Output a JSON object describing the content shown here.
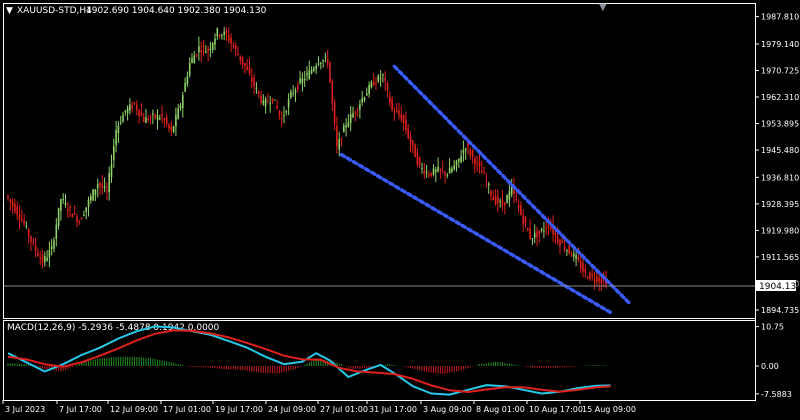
{
  "header": {
    "symbol": "XAUUSD-STD,H4",
    "ohlc": "1902.690 1904.640 1902.380 1904.130"
  },
  "indicator": {
    "label": "MACD(12,26,9) -5.2936 -5.4878 0.1942 0.0000"
  },
  "colors": {
    "background": "#000000",
    "grid_line": "#ffffff",
    "bull_candle": "#8fd36a",
    "bear_candle": "#e0201b",
    "channel": "#3a5bff",
    "macd_main": "#27c9e8",
    "macd_signal": "#e0201b",
    "hist_pos": "#1e8f1e",
    "hist_neg": "#c01a1a",
    "price_tag_bg": "#ffffff",
    "price_tag_text": "#000000",
    "text": "#ffffff"
  },
  "chart_data": [
    {
      "type": "candlestick",
      "title": "XAUUSD-STD,H4",
      "price_axis_ticks": [
        "1987.810",
        "1979.140",
        "1970.725",
        "1962.310",
        "1953.895",
        "1945.480",
        "1936.810",
        "1928.395",
        "1919.980",
        "1911.565",
        "1903.150",
        "1894.735"
      ],
      "ylim": [
        1892.5,
        1991.5
      ],
      "current_price": "1904.130",
      "time_axis_ticks": [
        "3 Jul 2023",
        "7 Jul 17:00",
        "12 Jul 09:00",
        "17 Jul 01:00",
        "19 Jul 17:00",
        "24 Jul 09:00",
        "27 Jul 01:00",
        "31 Jul 17:00",
        "3 Aug 09:00",
        "8 Aug 01:00",
        "10 Aug 17:00",
        "15 Aug 09:00"
      ],
      "price_path": [
        [
          0,
          1931
        ],
        [
          4,
          1927
        ],
        [
          8,
          1922
        ],
        [
          12,
          1915
        ],
        [
          16,
          1910
        ],
        [
          20,
          1914
        ],
        [
          24,
          1930
        ],
        [
          28,
          1926
        ],
        [
          32,
          1923
        ],
        [
          36,
          1929
        ],
        [
          40,
          1935
        ],
        [
          44,
          1932
        ],
        [
          48,
          1952
        ],
        [
          52,
          1958
        ],
        [
          56,
          1960
        ],
        [
          60,
          1955
        ],
        [
          64,
          1956
        ],
        [
          68,
          1956
        ],
        [
          72,
          1951
        ],
        [
          76,
          1960
        ],
        [
          80,
          1973
        ],
        [
          84,
          1978
        ],
        [
          88,
          1977
        ],
        [
          92,
          1983
        ],
        [
          96,
          1982
        ],
        [
          100,
          1977
        ],
        [
          104,
          1972
        ],
        [
          108,
          1966
        ],
        [
          112,
          1960
        ],
        [
          116,
          1962
        ],
        [
          120,
          1955
        ],
        [
          124,
          1963
        ],
        [
          128,
          1967
        ],
        [
          132,
          1970
        ],
        [
          136,
          1974
        ],
        [
          140,
          1974
        ],
        [
          144,
          1946
        ],
        [
          148,
          1954
        ],
        [
          152,
          1958
        ],
        [
          156,
          1963
        ],
        [
          160,
          1967
        ],
        [
          164,
          1969
        ],
        [
          168,
          1958
        ],
        [
          172,
          1956
        ],
        [
          176,
          1948
        ],
        [
          180,
          1940
        ],
        [
          184,
          1938
        ],
        [
          188,
          1939
        ],
        [
          192,
          1938
        ],
        [
          196,
          1941
        ],
        [
          200,
          1947
        ],
        [
          204,
          1942
        ],
        [
          208,
          1937
        ],
        [
          212,
          1930
        ],
        [
          216,
          1928
        ],
        [
          220,
          1933
        ],
        [
          224,
          1925
        ],
        [
          228,
          1918
        ],
        [
          232,
          1919
        ],
        [
          236,
          1922
        ],
        [
          240,
          1917
        ],
        [
          244,
          1914
        ],
        [
          248,
          1911
        ],
        [
          252,
          1906
        ],
        [
          256,
          1905
        ],
        [
          260,
          1904
        ]
      ],
      "channel": {
        "upper_start": [
          168,
          1972
        ],
        "upper_end": [
          270,
          1897
        ],
        "lower_start": [
          145,
          1944
        ],
        "lower_end": [
          263,
          1893.5
        ]
      }
    },
    {
      "type": "line",
      "title": "MACD(12,26,9)",
      "axis_ticks": [
        "10.75",
        "0.00",
        "-7.5883"
      ],
      "ylim": [
        -9.0,
        12.0
      ],
      "series": [
        {
          "role": "main",
          "points": [
            [
              0,
              3.5
            ],
            [
              8,
              1.0
            ],
            [
              16,
              -1.5
            ],
            [
              24,
              0.5
            ],
            [
              32,
              3.0
            ],
            [
              40,
              5.0
            ],
            [
              48,
              7.5
            ],
            [
              56,
              9.5
            ],
            [
              64,
              10.8
            ],
            [
              72,
              10.5
            ],
            [
              80,
              9.5
            ],
            [
              88,
              8.5
            ],
            [
              96,
              6.8
            ],
            [
              104,
              5.0
            ],
            [
              112,
              2.5
            ],
            [
              120,
              0.5
            ],
            [
              128,
              1.2
            ],
            [
              134,
              3.5
            ],
            [
              140,
              1.5
            ],
            [
              148,
              -3.0
            ],
            [
              156,
              -1.0
            ],
            [
              162,
              0.3
            ],
            [
              168,
              -2.0
            ],
            [
              176,
              -5.5
            ],
            [
              184,
              -7.5
            ],
            [
              192,
              -7.8
            ],
            [
              200,
              -6.5
            ],
            [
              208,
              -5.2
            ],
            [
              216,
              -5.5
            ],
            [
              224,
              -6.5
            ],
            [
              232,
              -7.5
            ],
            [
              240,
              -7.0
            ],
            [
              248,
              -6.0
            ],
            [
              256,
              -5.4
            ],
            [
              262,
              -5.3
            ]
          ]
        },
        {
          "role": "signal",
          "points": [
            [
              0,
              2.5
            ],
            [
              8,
              1.8
            ],
            [
              16,
              0.5
            ],
            [
              24,
              -0.2
            ],
            [
              32,
              1.0
            ],
            [
              40,
              2.8
            ],
            [
              48,
              4.8
            ],
            [
              56,
              7.0
            ],
            [
              64,
              8.8
            ],
            [
              72,
              9.7
            ],
            [
              80,
              9.6
            ],
            [
              88,
              8.9
            ],
            [
              96,
              7.8
            ],
            [
              104,
              6.3
            ],
            [
              112,
              4.6
            ],
            [
              120,
              2.8
            ],
            [
              128,
              1.8
            ],
            [
              136,
              1.7
            ],
            [
              144,
              -0.5
            ],
            [
              152,
              -1.5
            ],
            [
              160,
              -1.8
            ],
            [
              168,
              -2.2
            ],
            [
              176,
              -3.5
            ],
            [
              184,
              -5.3
            ],
            [
              192,
              -6.6
            ],
            [
              200,
              -7.1
            ],
            [
              208,
              -6.4
            ],
            [
              216,
              -5.8
            ],
            [
              224,
              -5.8
            ],
            [
              232,
              -6.5
            ],
            [
              240,
              -7.0
            ],
            [
              248,
              -6.5
            ],
            [
              256,
              -5.8
            ],
            [
              262,
              -5.5
            ]
          ]
        }
      ],
      "histogram": [
        0.8,
        0.5,
        -0.8,
        -1.5,
        0.7,
        2.0,
        2.5,
        2.5,
        2.0,
        1.0,
        -0.2,
        -0.4,
        -0.9,
        -1.1,
        -1.9,
        -2.0,
        -0.6,
        1.9,
        1.2,
        -0.8,
        -0.5,
        0.5,
        -0.3,
        -1.5,
        -2.2,
        -1.2,
        0.5,
        1.2,
        0.3,
        -0.5,
        -0.5,
        -0.3,
        0.2,
        0.2
      ]
    }
  ]
}
